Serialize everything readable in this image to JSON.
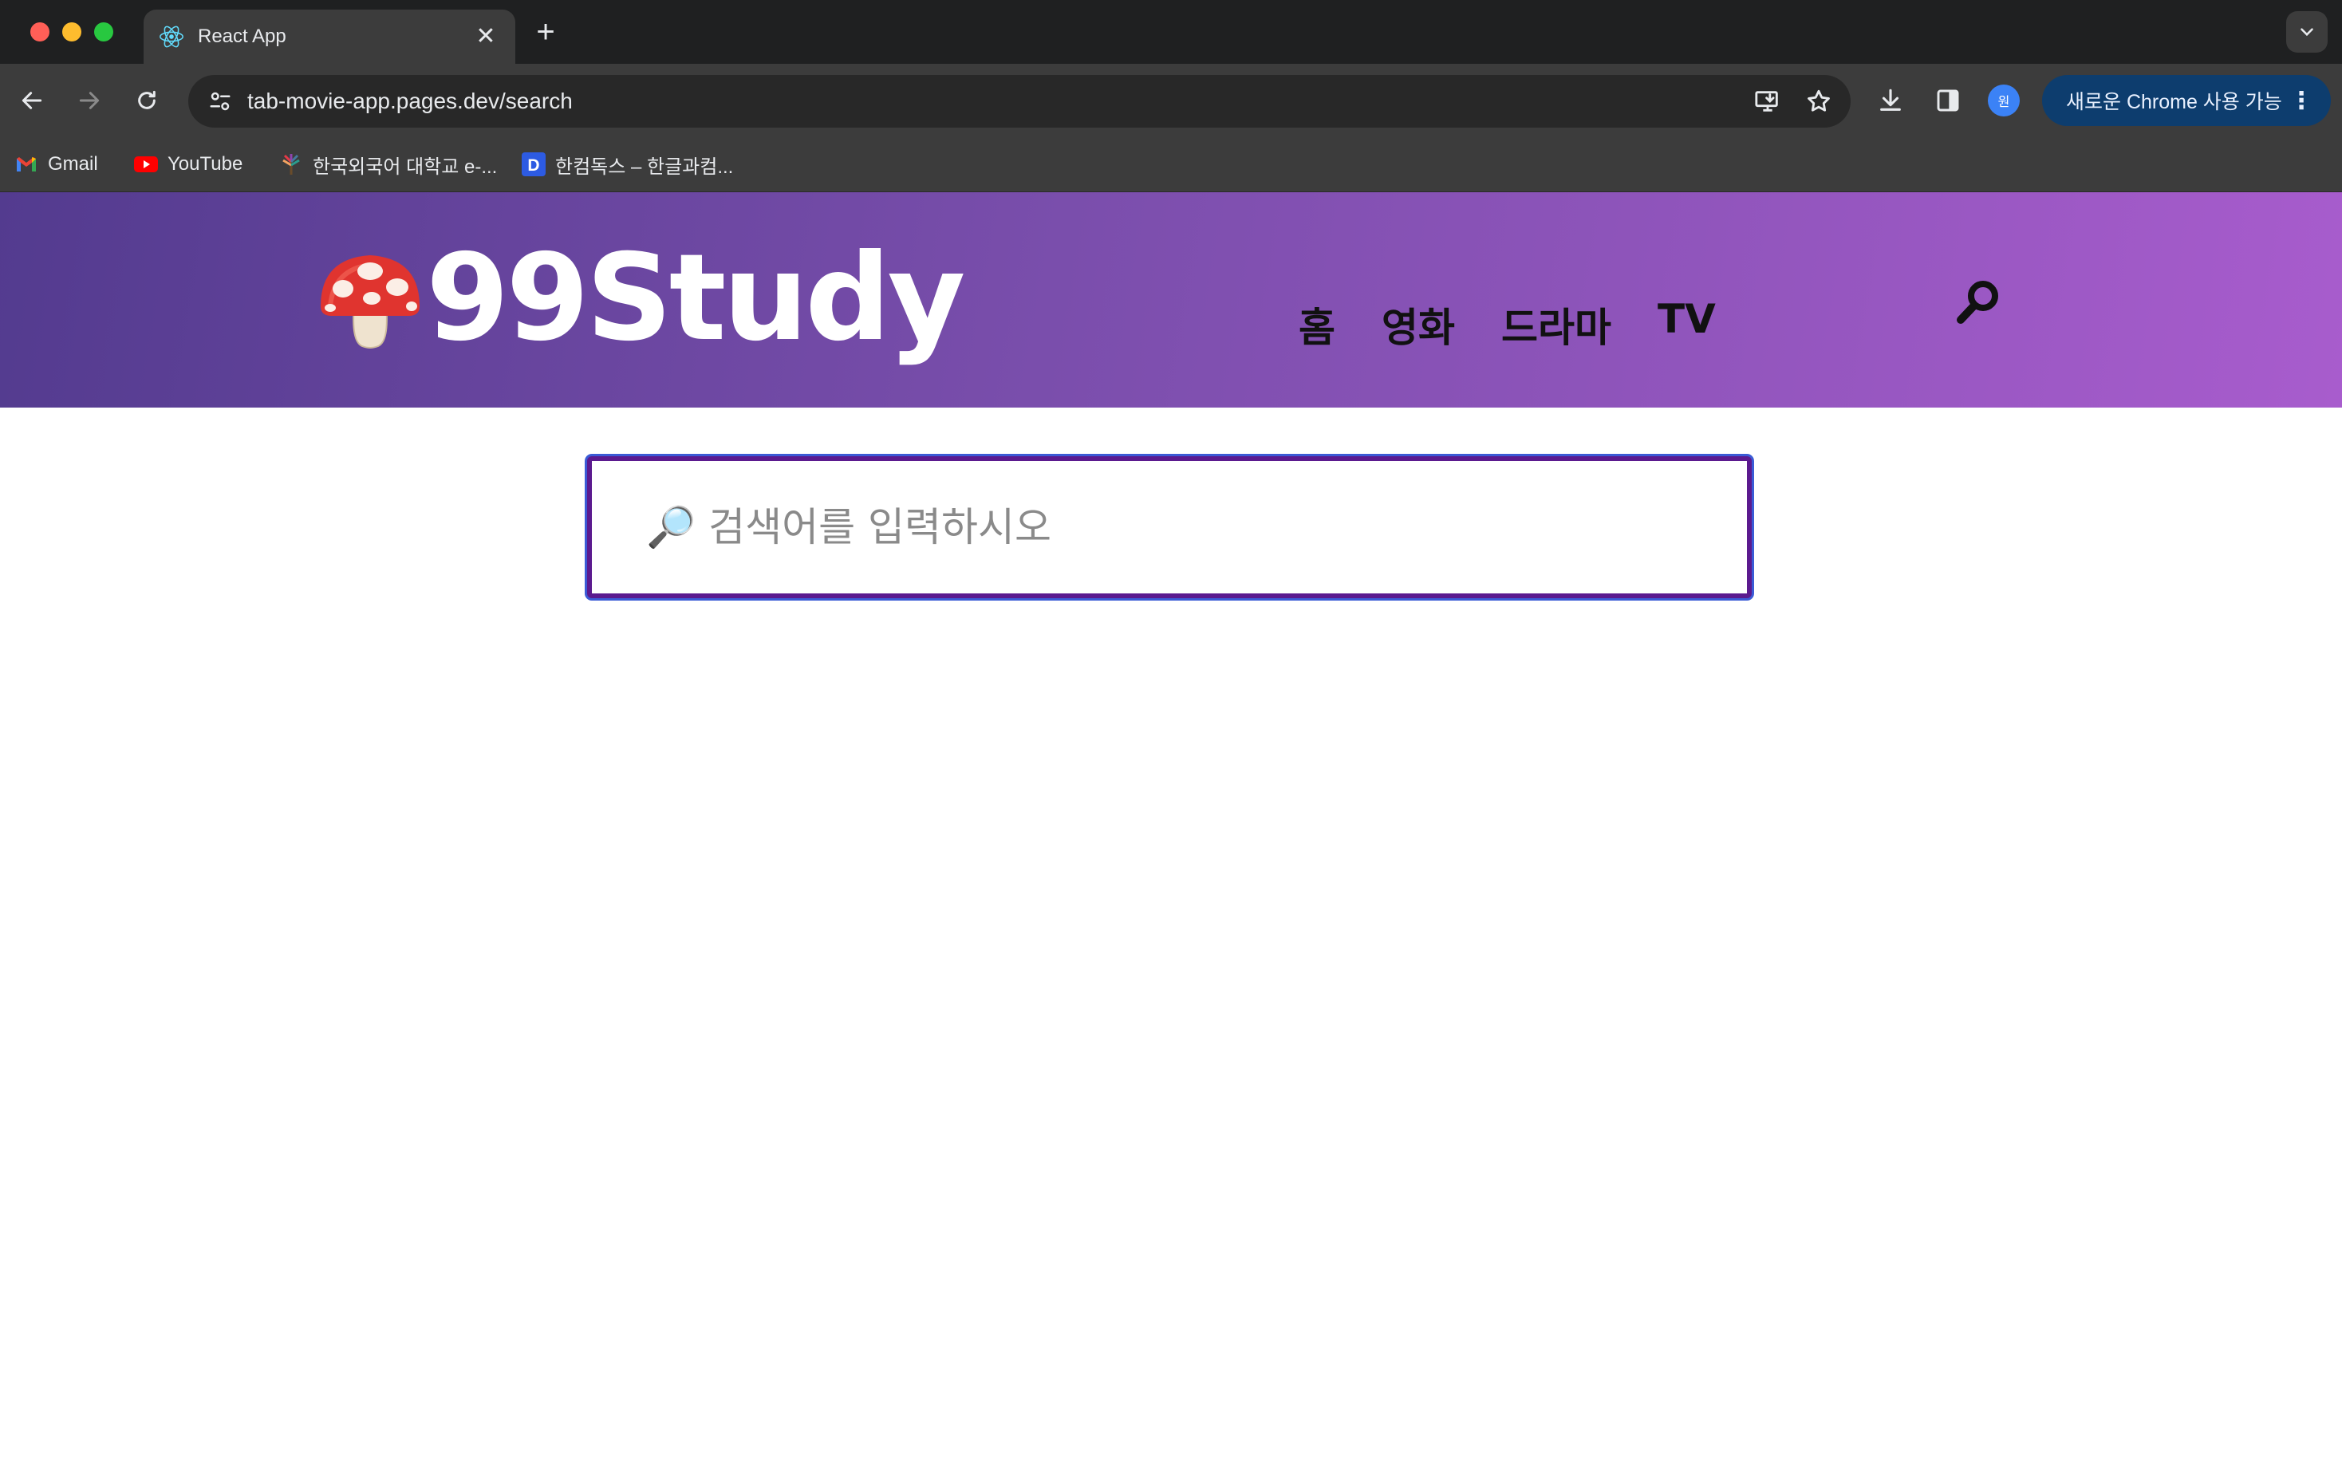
{
  "browser": {
    "tab": {
      "title": "React App"
    },
    "address": {
      "url": "tab-movie-app.pages.dev/search"
    },
    "profile_initial": "원",
    "update_chip": {
      "label": "새로운 Chrome 사용 가능"
    },
    "bookmarks": [
      {
        "label": "Gmail",
        "icon": "gmail-icon"
      },
      {
        "label": "YouTube",
        "icon": "youtube-icon"
      },
      {
        "label": "한국외국어 대학교 e-...",
        "icon": "hufs-icon"
      },
      {
        "label": "한컴독스 – 한글과컴...",
        "icon": "hancom-docs-icon"
      }
    ]
  },
  "site": {
    "logo_text": "99Study",
    "logo_icon": "mushroom-icon",
    "nav": [
      {
        "label": "홈"
      },
      {
        "label": "영화"
      },
      {
        "label": "드라마"
      },
      {
        "label": "TV"
      }
    ],
    "search": {
      "placeholder": "🔎 검색어를 입력하시오",
      "value": ""
    }
  },
  "colors": {
    "header_start": "#533b8f",
    "header_end": "#a85ccd",
    "search_border": "#5b1a8f",
    "search_focus_ring": "#3b5bd6"
  }
}
